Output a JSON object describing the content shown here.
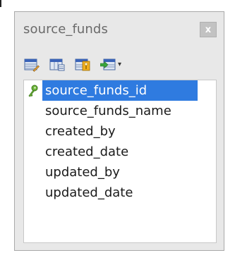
{
  "window": {
    "title": "source_funds",
    "close_label": "x"
  },
  "toolbar": {
    "buttons": [
      {
        "icon": "table-edit-icon"
      },
      {
        "icon": "table-columns-icon"
      },
      {
        "icon": "table-key-icon"
      },
      {
        "icon": "table-import-icon"
      }
    ],
    "dropdown_arrow": "▾"
  },
  "fields": [
    {
      "name": "source_funds_id",
      "primary_key": true,
      "selected": true
    },
    {
      "name": "source_funds_name",
      "primary_key": false,
      "selected": false
    },
    {
      "name": "created_by",
      "primary_key": false,
      "selected": false
    },
    {
      "name": "created_date",
      "primary_key": false,
      "selected": false
    },
    {
      "name": "updated_by",
      "primary_key": false,
      "selected": false
    },
    {
      "name": "updated_date",
      "primary_key": false,
      "selected": false
    }
  ],
  "colors": {
    "selection": "#2f7be0",
    "window_bg": "#e8e8e8",
    "title_text": "#6a6a6a",
    "key_icon": "#5a9a2a"
  }
}
